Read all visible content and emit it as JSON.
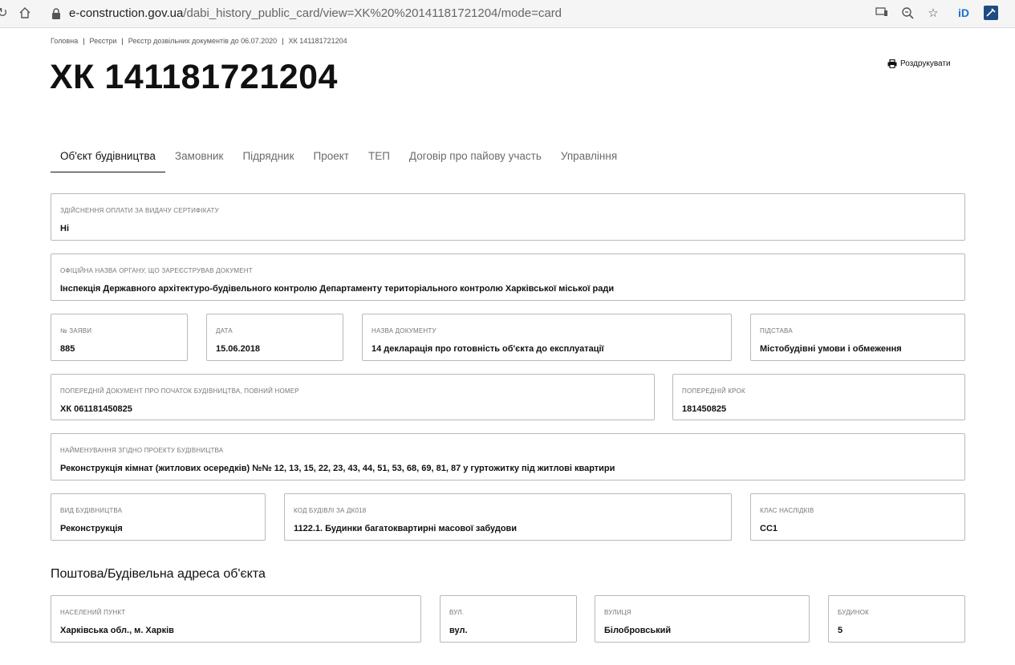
{
  "browser": {
    "url_host": "e-construction.gov.ua",
    "url_path": "/dabi_history_public_card/view=XK%20%20141181721204/mode=card",
    "ext_label": "iD"
  },
  "breadcrumb": [
    "Головна",
    "Реєстри",
    "Реєстр дозвільних документів до 06.07.2020",
    "ХК 141181721204"
  ],
  "page_title": "ХК 141181721204",
  "print_label": "Роздрукувати",
  "tabs": [
    "Об'єкт будівництва",
    "Замовник",
    "Підрядник",
    "Проект",
    "ТЕП",
    "Договір про пайову участь",
    "Управління"
  ],
  "fields": {
    "payment": {
      "label": "Здійснення оплати за видачу сертифікату",
      "value": "Ні"
    },
    "authority": {
      "label": "Офіційна назва органу, що зареєстрував документ",
      "value": "Інспекція Державного архітектуро-будівельного контролю Департаменту територіального контролю Харківської міської ради"
    },
    "app_no": {
      "label": "№ заяви",
      "value": "885"
    },
    "date": {
      "label": "Дата",
      "value": "15.06.2018"
    },
    "doc_name": {
      "label": "Назва документу",
      "value": "14 декларація про готовність об'єкта до експлуатації"
    },
    "basis": {
      "label": "Підстава",
      "value": "Містобудівні умови і обмеження"
    },
    "prev_doc": {
      "label": "Попередній документ про початок будівництва, повний номер",
      "value": "ХК 061181450825"
    },
    "prev_step": {
      "label": "Попередній крок",
      "value": "181450825"
    },
    "project_name": {
      "label": "Найменування згідно проекту будівництва",
      "value": "Реконструкція кімнат (житлових осередків) №№ 12, 13, 15, 22, 23, 43, 44, 51, 53, 68, 69, 81, 87 у гуртожитку під житлові квартири"
    },
    "build_type": {
      "label": "Вид будівництва",
      "value": "Реконструкція"
    },
    "dk_code": {
      "label": "Код будівлі за ДК018",
      "value": "1122.1. Будинки багатоквартирні масової забудови"
    },
    "class": {
      "label": "Клас наслідків",
      "value": "СС1"
    }
  },
  "address_section": {
    "title": "Поштова/Будівельна адреса об'єкта",
    "settlement": {
      "label": "Населений пункт",
      "value": "Харківська обл., м. Харків"
    },
    "street_type": {
      "label": "Вул.",
      "value": "вул."
    },
    "street": {
      "label": "Вулиця",
      "value": "Білобровський"
    },
    "house": {
      "label": "Будинок",
      "value": "5"
    }
  }
}
